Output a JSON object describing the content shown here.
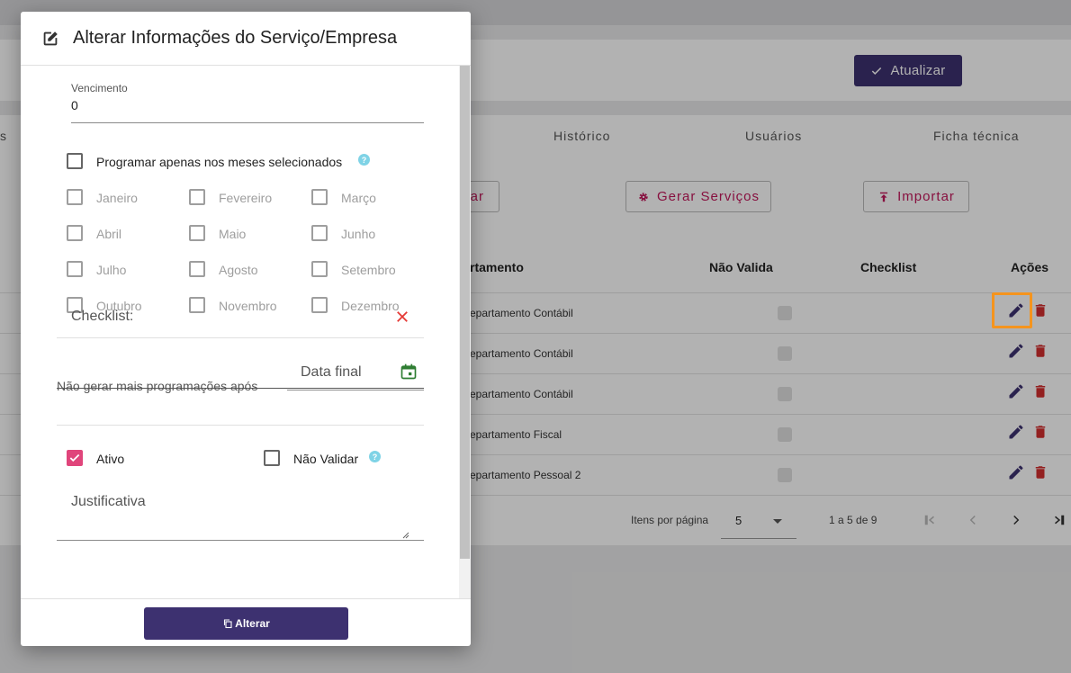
{
  "background": {
    "atualizar_label": "Atualizar",
    "tabs": [
      "s",
      "Histórico",
      "Usuários",
      "Ficha técnica"
    ],
    "buttons": {
      "partial_label": "ar",
      "gerar_label": "Gerar Serviços",
      "importar_label": "Importar"
    },
    "table": {
      "headers": [
        "rtamento",
        "Não Valida",
        "Checklist",
        "Ações"
      ],
      "rows": [
        {
          "dept": "epartamento Contábil"
        },
        {
          "dept": "epartamento Contábil"
        },
        {
          "dept": "epartamento Contábil"
        },
        {
          "dept": "epartamento Fiscal"
        },
        {
          "dept": "epartamento Pessoal 2"
        }
      ]
    },
    "paginator": {
      "items_per_page_label": "Itens por página",
      "page_size": "5",
      "range": "1 a 5 de 9"
    }
  },
  "modal": {
    "title": "Alterar Informações do Serviço/Empresa",
    "vencimento": {
      "label": "Vencimento",
      "value": "0"
    },
    "programar": {
      "label": "Programar apenas nos meses selecionados",
      "checked": false
    },
    "months": [
      [
        "Janeiro",
        "Fevereiro",
        "Março"
      ],
      [
        "Abril",
        "Maio",
        "Junho"
      ],
      [
        "Julho",
        "Agosto",
        "Setembro"
      ],
      [
        "Outubro",
        "Novembro",
        "Dezembro"
      ]
    ],
    "checklist_placeholder": "Checklist:",
    "nao_gerar_label": "Não gerar mais programações após",
    "data_final_placeholder": "Data final",
    "ativo_label": "Ativo",
    "ativo_checked": true,
    "nao_validar_label": "Não Validar",
    "nao_validar_checked": false,
    "justificativa_placeholder": "Justificativa",
    "submit_label": "Alterar"
  },
  "colors": {
    "primary": "#3d3170",
    "accent": "#e0457b",
    "danger": "#d32f2f",
    "highlight": "#f5941d",
    "success_icon": "#2e7d32"
  }
}
